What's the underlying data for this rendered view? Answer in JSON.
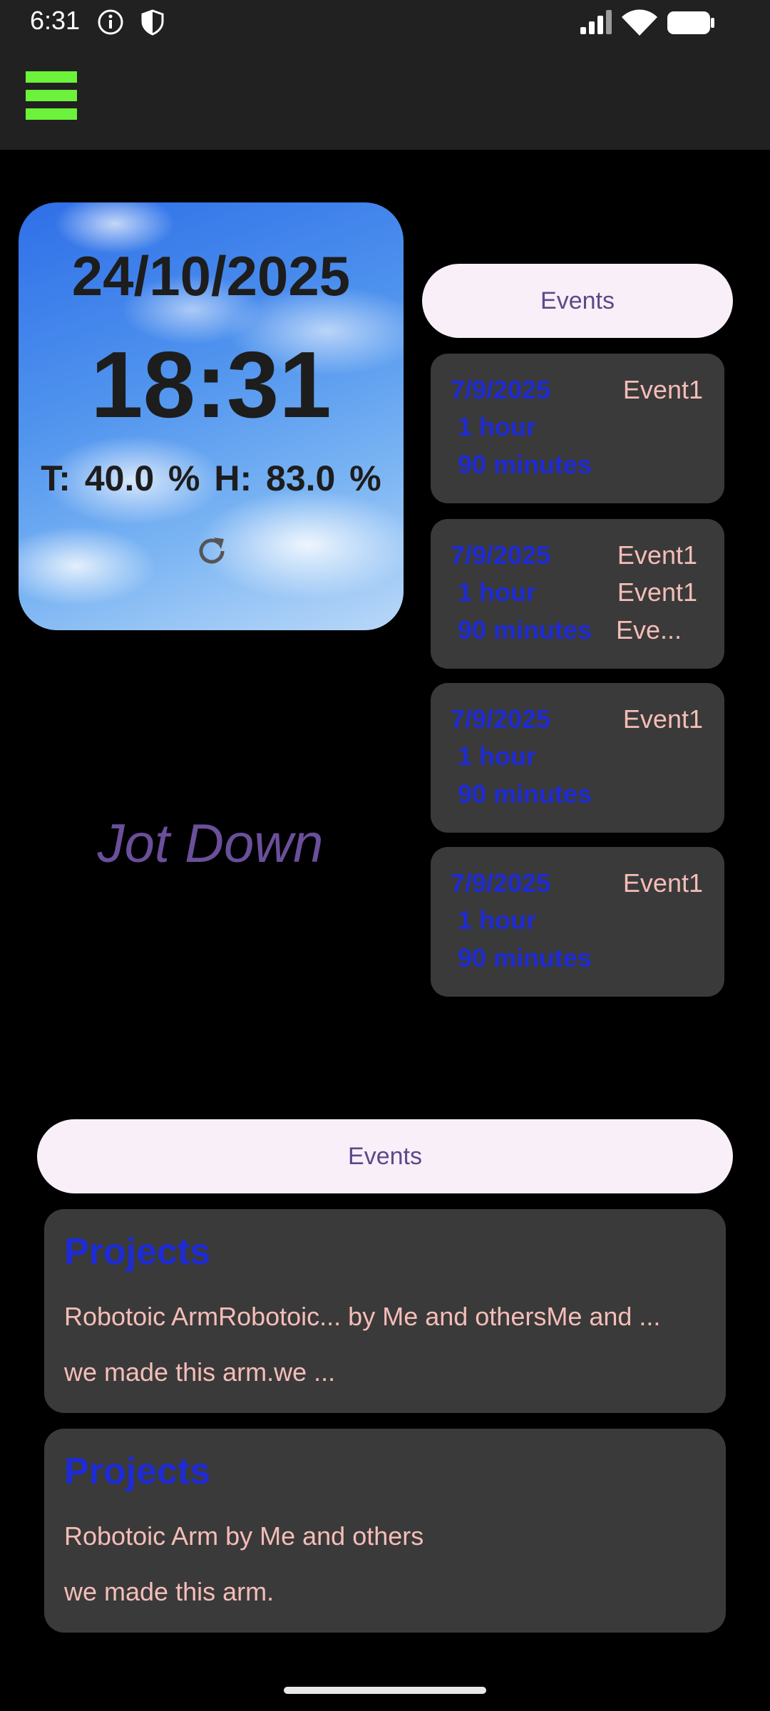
{
  "status_bar": {
    "time": "6:31",
    "icons": [
      "info-icon",
      "shield-icon",
      "signal-icon",
      "wifi-icon",
      "battery-icon"
    ]
  },
  "app_bar": {
    "menu_icon": "hamburger-menu-icon",
    "menu_color": "#6cf23a"
  },
  "weather": {
    "date": "24/10/2025",
    "time": "18:31",
    "temp_humidity": "T: 40.0 %  H: 83.0 %",
    "refresh_icon": "refresh-icon"
  },
  "jot_down": "Jot Down",
  "events_button_label": "Events",
  "events": [
    {
      "date": "7/9/2025",
      "duration1": "1 hour",
      "duration2": "90 minutes",
      "names": [
        "Event1"
      ]
    },
    {
      "date": "7/9/2025",
      "duration1": "1 hour",
      "duration2": "90 minutes",
      "names": [
        "Event1",
        "Event1",
        "Eve..."
      ]
    },
    {
      "date": "7/9/2025",
      "duration1": "1 hour",
      "duration2": "90 minutes",
      "names": [
        "Event1"
      ]
    },
    {
      "date": "7/9/2025",
      "duration1": "1 hour",
      "duration2": "90 minutes",
      "names": [
        "Event1"
      ]
    }
  ],
  "bottom_button_label": "Events",
  "projects": [
    {
      "title": "Projects",
      "line1": "Robotoic ArmRobotoic...  by Me and othersMe and ...",
      "line2": "we made this arm.we ..."
    },
    {
      "title": "Projects",
      "line1": "Robotoic Arm  by Me and others",
      "line2": "we made this arm."
    }
  ],
  "colors": {
    "accent_blue": "#1e2bd6",
    "event_name": "#f5bdb8",
    "card_bg": "#3a3a3a",
    "pill_bg": "#f8eff8",
    "pill_text": "#5a4a8a"
  }
}
